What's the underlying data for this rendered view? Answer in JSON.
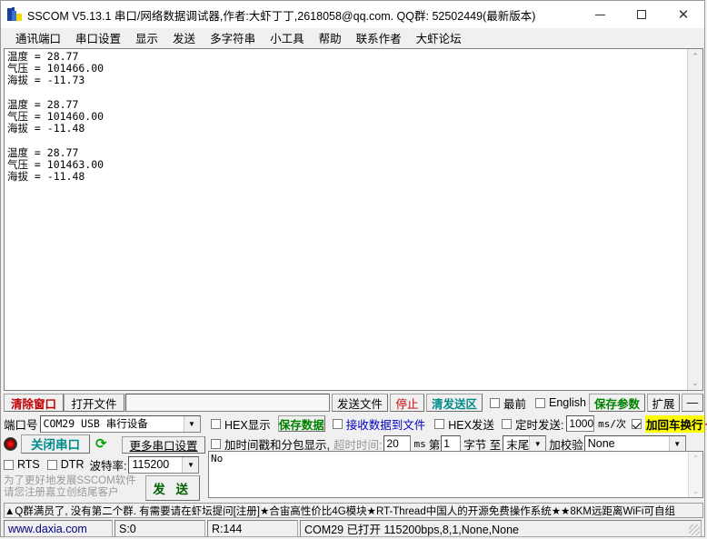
{
  "window": {
    "title": "SSCOM V5.13.1 串口/网络数据调试器,作者:大虾丁丁,2618058@qq.com. QQ群: 52502449(最新版本)",
    "app_icon": "sscom-shrimp-icon",
    "minimize": "—",
    "maximize": "□",
    "close": "✕"
  },
  "menubar": {
    "items": [
      {
        "label": "通讯端口"
      },
      {
        "label": "串口设置"
      },
      {
        "label": "显示"
      },
      {
        "label": "发送"
      },
      {
        "label": "多字符串"
      },
      {
        "label": "小工具"
      },
      {
        "label": "帮助"
      },
      {
        "label": "联系作者"
      },
      {
        "label": "大虾论坛"
      }
    ]
  },
  "receive": {
    "content": "温度 = 28.77\n气压 = 101466.00\n海拔 = -11.73\n\n温度 = 28.77\n气压 = 101460.00\n海拔 = -11.48\n\n温度 = 28.77\n气压 = 101463.00\n海拔 = -11.48\n",
    "scroll_up": "⌃",
    "scroll_down": "⌄"
  },
  "toolbar": {
    "clear_window": "清除窗口",
    "open_file": "打开文件",
    "file_path": "",
    "send_file": "发送文件",
    "stop": "停止",
    "clear_send": "清发送区",
    "topmost_label": "最前",
    "topmost_checked": false,
    "english_label": "English",
    "english_checked": false,
    "save_params": "保存参数",
    "expand": "扩展",
    "minus": "—"
  },
  "port_panel": {
    "port_label": "端口号",
    "port_value": "COM29 USB 串行设备",
    "close_port_button": "关闭串口",
    "refresh_icon": "refresh-icon",
    "more_settings": "更多串口设置",
    "rts_label": "RTS",
    "rts_checked": false,
    "dtr_label": "DTR",
    "dtr_checked": false,
    "baud_label": "波特率:",
    "baud_value": "115200",
    "promo_line1": "为了更好地发展SSCOM软件",
    "promo_line2": "请您注册嘉立创结尾客户",
    "send_button": "发 送"
  },
  "options": {
    "hex_display_label": "HEX显示",
    "hex_display_checked": false,
    "save_data": "保存数据",
    "recv_to_file_label": "接收数据到文件",
    "recv_to_file_checked": false,
    "hex_send_label": "HEX发送",
    "hex_send_checked": false,
    "timed_send_label": "定时发送:",
    "timed_send_checked": false,
    "timed_send_value": "1000",
    "ms_per_time": "ms/次",
    "crlf_label": "加回车换行",
    "crlf_checked": true,
    "help_mark": "?",
    "timestamp_label": "加时间戳和分包显示,",
    "timestamp_checked": false,
    "timeout_label": "超时时间:",
    "timeout_value": "20",
    "ms_unit": "ms",
    "byte_from_label": "第",
    "byte_from_value": "1",
    "byte_label": "字节 至",
    "byte_to_value": "末尾",
    "checksum_label": "加校验",
    "checksum_value": "None"
  },
  "send_area": {
    "content": "No",
    "scroll_up": "⌃",
    "scroll_down": "⌄"
  },
  "ad_bar": {
    "segments": [
      {
        "text": "▲Q群满员了, 没有第二个群. 有需要请在虾坛提问[注册]",
        "color": "black"
      },
      {
        "text": "★合宙高性价比4G模块",
        "color": "black"
      },
      {
        "text": "  ★RT-Thread中国人的开源免费操作系统",
        "color": "black"
      },
      {
        "text": "  ★",
        "color": "black"
      },
      {
        "text": "  ★8KM远距离WiFi可自组",
        "color": "black"
      }
    ]
  },
  "statusbar": {
    "website": "www.daxia.com",
    "sent": "S:0",
    "received": "R:144",
    "connection": "COM29 已打开  115200bps,8,1,None,None"
  },
  "colors": {
    "accent_red": "#c00000",
    "accent_green": "#008000",
    "accent_teal": "#008b8b",
    "accent_blue": "#0000c0",
    "highlight_yellow": "#ffff00"
  }
}
